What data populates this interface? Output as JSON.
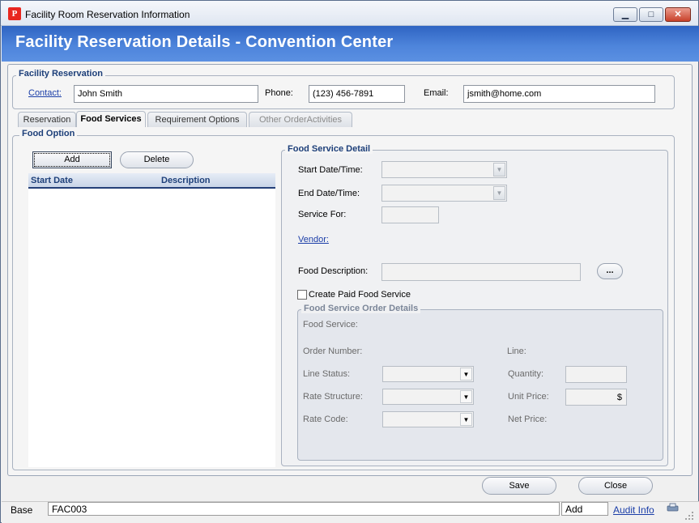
{
  "window": {
    "title": "Facility Room Reservation Information",
    "app_icon_glyph": "P",
    "minimize": "▁",
    "maximize": "□",
    "close": "✕"
  },
  "header": {
    "title": "Facility Reservation Details - Convention Center"
  },
  "facility_reservation": {
    "legend": "Facility Reservation",
    "contact_label": "Contact:",
    "contact_value": "John Smith",
    "phone_label": "Phone:",
    "phone_value": "(123) 456-7891",
    "email_label": "Email:",
    "email_value": "jsmith@home.com"
  },
  "tabs": [
    {
      "label": "Reservation"
    },
    {
      "label": "Food Services"
    },
    {
      "label": "Requirement Options"
    },
    {
      "label": "Other OrderActivities"
    }
  ],
  "food_option": {
    "legend": "Food Option",
    "add_label": "Add",
    "delete_label": "Delete",
    "columns": [
      "Start Date",
      "Description"
    ]
  },
  "food_service_detail": {
    "legend": "Food Service Detail",
    "start_label": "Start Date/Time:",
    "end_label": "End Date/Time:",
    "service_for_label": "Service For:",
    "vendor_label": "Vendor:",
    "food_description_label": "Food Description:",
    "ellipsis_label": "...",
    "create_paid_label": "Create Paid Food Service"
  },
  "order_details": {
    "legend": "Food Service Order Details",
    "food_service_label": "Food Service:",
    "order_number_label": "Order Number:",
    "line_label": "Line:",
    "line_status_label": "Line Status:",
    "quantity_label": "Quantity:",
    "rate_structure_label": "Rate Structure:",
    "unit_price_label": "Unit Price:",
    "unit_price_value": "$",
    "rate_code_label": "Rate Code:",
    "net_price_label": "Net Price:"
  },
  "footer": {
    "save_label": "Save",
    "close_label": "Close"
  },
  "statusbar": {
    "mode": "Base",
    "code": "FAC003",
    "state": "Add",
    "audit_label": "Audit Info"
  },
  "colors": {
    "header_blue": "#3f76d2",
    "legend_blue": "#1d3f79",
    "link_blue": "#1b3ea8"
  }
}
